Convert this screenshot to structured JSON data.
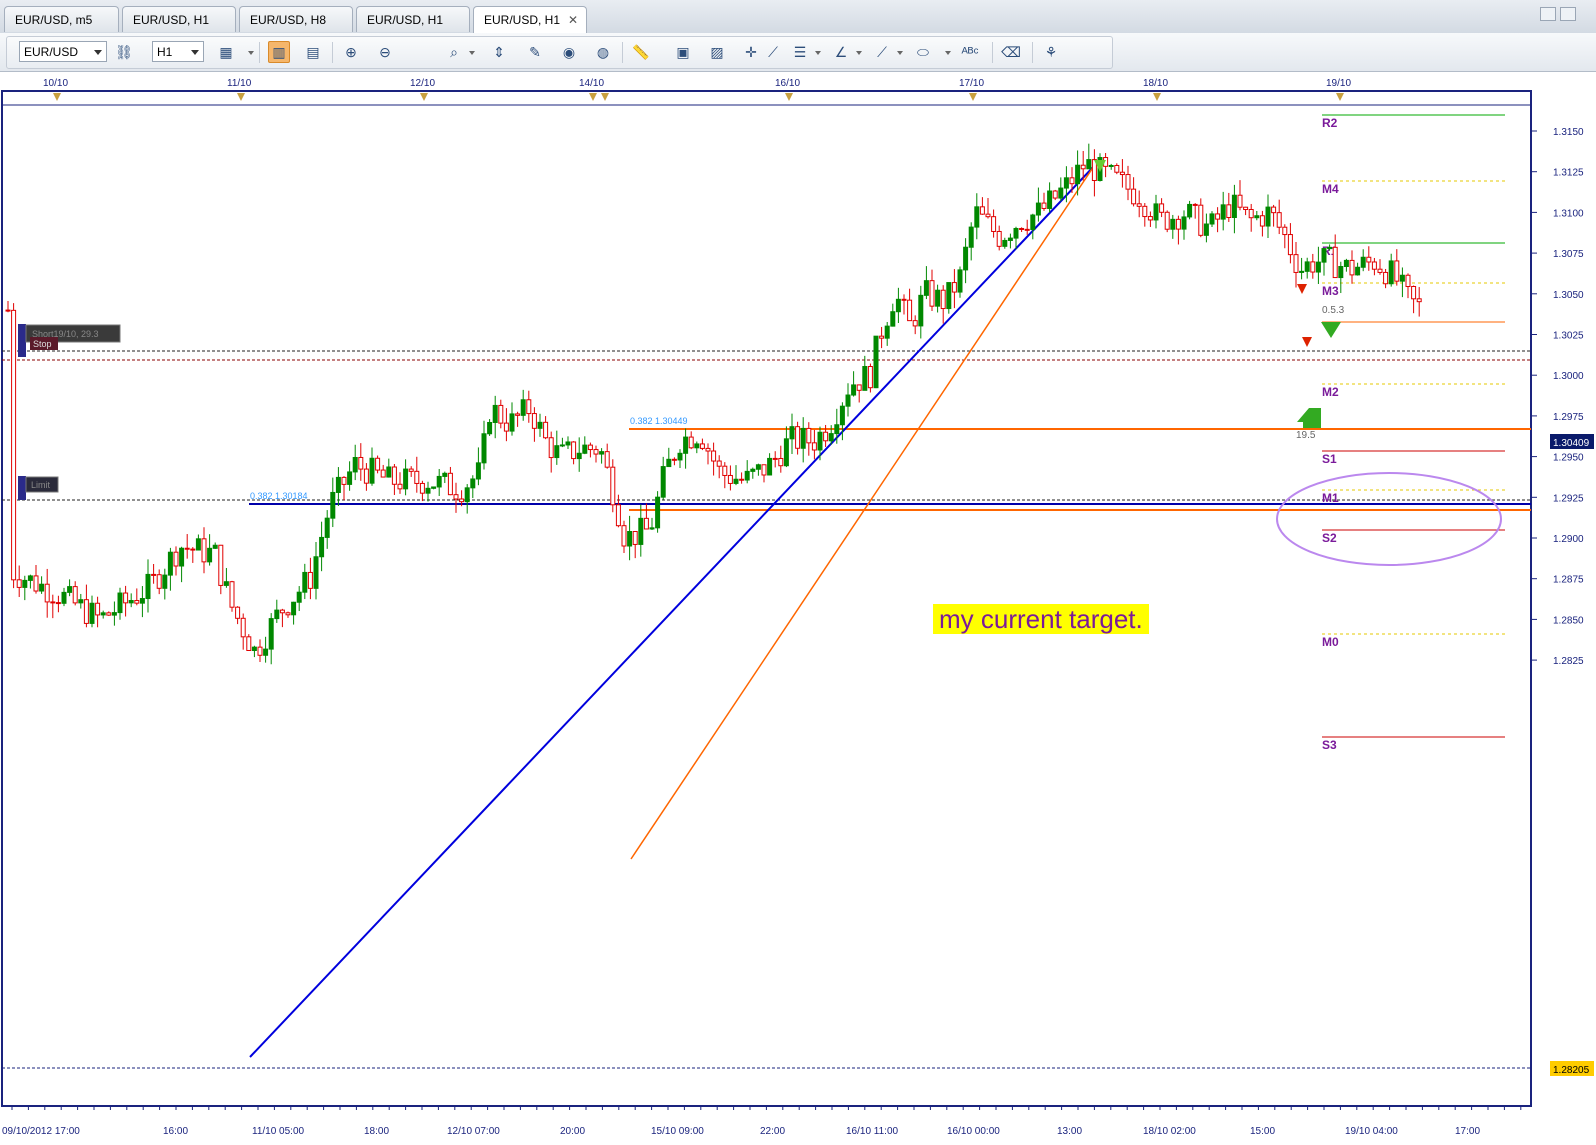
{
  "tabs": [
    {
      "label": "EUR/USD, m5"
    },
    {
      "label": "EUR/USD, H1"
    },
    {
      "label": "EUR/USD, H8"
    },
    {
      "label": "EUR/USD, H1"
    },
    {
      "label": "EUR/USD, H1",
      "active": true
    }
  ],
  "toolbar": {
    "symbol": "EUR/USD",
    "timeframe": "H1"
  },
  "top_dates": [
    "10/10",
    "11/10",
    "12/10",
    "14/10",
    "16/10",
    "17/10",
    "18/10",
    "19/10"
  ],
  "bottom_times": [
    "09/10/2012 17:00",
    "16:00",
    "11/10 05:00",
    "18:00",
    "12/10 07:00",
    "20:00",
    "15/10 09:00",
    "22:00",
    "16/10 11:00",
    "16/10 00:00",
    "13:00",
    "18/10 02:00",
    "15:00",
    "19/10 04:00",
    "17:00"
  ],
  "price_axis": [
    "1.3150",
    "1.3125",
    "1.3100",
    "1.3075",
    "1.3050",
    "1.3025",
    "1.3000",
    "1.2975",
    "1.2950",
    "1.2925",
    "1.2900",
    "1.2875",
    "1.2850",
    "1.2825"
  ],
  "price_markers": {
    "current": "1.30409",
    "lower": "1.28205"
  },
  "pivot_levels": [
    {
      "label": "R2",
      "color": "#00aa00"
    },
    {
      "label": "M4",
      "color": "#e6c800"
    },
    {
      "label": "R1",
      "color": "#00aa00"
    },
    {
      "label": "M3",
      "color": "#e6c800"
    },
    {
      "label": "M2",
      "color": "#e6c800"
    },
    {
      "label": "S1",
      "color": "#cc0000"
    },
    {
      "label": "M1",
      "color": "#e6c800"
    },
    {
      "label": "S2",
      "color": "#cc0000"
    },
    {
      "label": "M0",
      "color": "#e6c800"
    },
    {
      "label": "S3",
      "color": "#cc0000"
    }
  ],
  "fib_labels": {
    "orange": "0.382 1.30449",
    "blue": "0.382 1.30184"
  },
  "orders": {
    "stop_label": "Stop",
    "stop_tag": "Short19/10, 29.3",
    "limit_label": "Limit"
  },
  "signal_labels": {
    "upper": "0.5.3",
    "lower": "19.5"
  },
  "annotation": "my current target.",
  "colors": {
    "bull": "#008800",
    "bear": "#e00000",
    "trend_blue": "#0000dd",
    "trend_orange": "#ff6600",
    "ellipse": "#bb88ee"
  }
}
